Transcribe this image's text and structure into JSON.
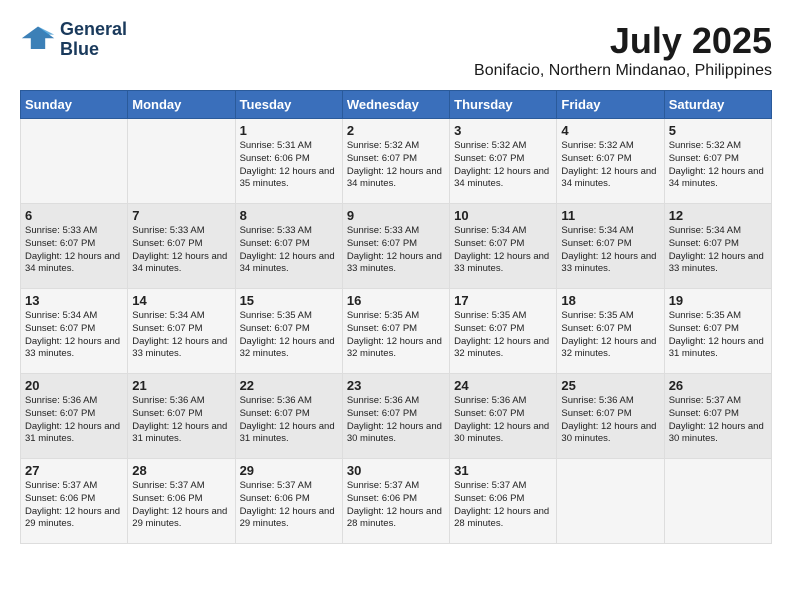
{
  "logo": {
    "line1": "General",
    "line2": "Blue"
  },
  "title": "July 2025",
  "subtitle": "Bonifacio, Northern Mindanao, Philippines",
  "days_of_week": [
    "Sunday",
    "Monday",
    "Tuesday",
    "Wednesday",
    "Thursday",
    "Friday",
    "Saturday"
  ],
  "weeks": [
    [
      {
        "day": "",
        "info": ""
      },
      {
        "day": "",
        "info": ""
      },
      {
        "day": "1",
        "info": "Sunrise: 5:31 AM\nSunset: 6:06 PM\nDaylight: 12 hours and 35 minutes."
      },
      {
        "day": "2",
        "info": "Sunrise: 5:32 AM\nSunset: 6:07 PM\nDaylight: 12 hours and 34 minutes."
      },
      {
        "day": "3",
        "info": "Sunrise: 5:32 AM\nSunset: 6:07 PM\nDaylight: 12 hours and 34 minutes."
      },
      {
        "day": "4",
        "info": "Sunrise: 5:32 AM\nSunset: 6:07 PM\nDaylight: 12 hours and 34 minutes."
      },
      {
        "day": "5",
        "info": "Sunrise: 5:32 AM\nSunset: 6:07 PM\nDaylight: 12 hours and 34 minutes."
      }
    ],
    [
      {
        "day": "6",
        "info": "Sunrise: 5:33 AM\nSunset: 6:07 PM\nDaylight: 12 hours and 34 minutes."
      },
      {
        "day": "7",
        "info": "Sunrise: 5:33 AM\nSunset: 6:07 PM\nDaylight: 12 hours and 34 minutes."
      },
      {
        "day": "8",
        "info": "Sunrise: 5:33 AM\nSunset: 6:07 PM\nDaylight: 12 hours and 34 minutes."
      },
      {
        "day": "9",
        "info": "Sunrise: 5:33 AM\nSunset: 6:07 PM\nDaylight: 12 hours and 33 minutes."
      },
      {
        "day": "10",
        "info": "Sunrise: 5:34 AM\nSunset: 6:07 PM\nDaylight: 12 hours and 33 minutes."
      },
      {
        "day": "11",
        "info": "Sunrise: 5:34 AM\nSunset: 6:07 PM\nDaylight: 12 hours and 33 minutes."
      },
      {
        "day": "12",
        "info": "Sunrise: 5:34 AM\nSunset: 6:07 PM\nDaylight: 12 hours and 33 minutes."
      }
    ],
    [
      {
        "day": "13",
        "info": "Sunrise: 5:34 AM\nSunset: 6:07 PM\nDaylight: 12 hours and 33 minutes."
      },
      {
        "day": "14",
        "info": "Sunrise: 5:34 AM\nSunset: 6:07 PM\nDaylight: 12 hours and 33 minutes."
      },
      {
        "day": "15",
        "info": "Sunrise: 5:35 AM\nSunset: 6:07 PM\nDaylight: 12 hours and 32 minutes."
      },
      {
        "day": "16",
        "info": "Sunrise: 5:35 AM\nSunset: 6:07 PM\nDaylight: 12 hours and 32 minutes."
      },
      {
        "day": "17",
        "info": "Sunrise: 5:35 AM\nSunset: 6:07 PM\nDaylight: 12 hours and 32 minutes."
      },
      {
        "day": "18",
        "info": "Sunrise: 5:35 AM\nSunset: 6:07 PM\nDaylight: 12 hours and 32 minutes."
      },
      {
        "day": "19",
        "info": "Sunrise: 5:35 AM\nSunset: 6:07 PM\nDaylight: 12 hours and 31 minutes."
      }
    ],
    [
      {
        "day": "20",
        "info": "Sunrise: 5:36 AM\nSunset: 6:07 PM\nDaylight: 12 hours and 31 minutes."
      },
      {
        "day": "21",
        "info": "Sunrise: 5:36 AM\nSunset: 6:07 PM\nDaylight: 12 hours and 31 minutes."
      },
      {
        "day": "22",
        "info": "Sunrise: 5:36 AM\nSunset: 6:07 PM\nDaylight: 12 hours and 31 minutes."
      },
      {
        "day": "23",
        "info": "Sunrise: 5:36 AM\nSunset: 6:07 PM\nDaylight: 12 hours and 30 minutes."
      },
      {
        "day": "24",
        "info": "Sunrise: 5:36 AM\nSunset: 6:07 PM\nDaylight: 12 hours and 30 minutes."
      },
      {
        "day": "25",
        "info": "Sunrise: 5:36 AM\nSunset: 6:07 PM\nDaylight: 12 hours and 30 minutes."
      },
      {
        "day": "26",
        "info": "Sunrise: 5:37 AM\nSunset: 6:07 PM\nDaylight: 12 hours and 30 minutes."
      }
    ],
    [
      {
        "day": "27",
        "info": "Sunrise: 5:37 AM\nSunset: 6:06 PM\nDaylight: 12 hours and 29 minutes."
      },
      {
        "day": "28",
        "info": "Sunrise: 5:37 AM\nSunset: 6:06 PM\nDaylight: 12 hours and 29 minutes."
      },
      {
        "day": "29",
        "info": "Sunrise: 5:37 AM\nSunset: 6:06 PM\nDaylight: 12 hours and 29 minutes."
      },
      {
        "day": "30",
        "info": "Sunrise: 5:37 AM\nSunset: 6:06 PM\nDaylight: 12 hours and 28 minutes."
      },
      {
        "day": "31",
        "info": "Sunrise: 5:37 AM\nSunset: 6:06 PM\nDaylight: 12 hours and 28 minutes."
      },
      {
        "day": "",
        "info": ""
      },
      {
        "day": "",
        "info": ""
      }
    ]
  ]
}
